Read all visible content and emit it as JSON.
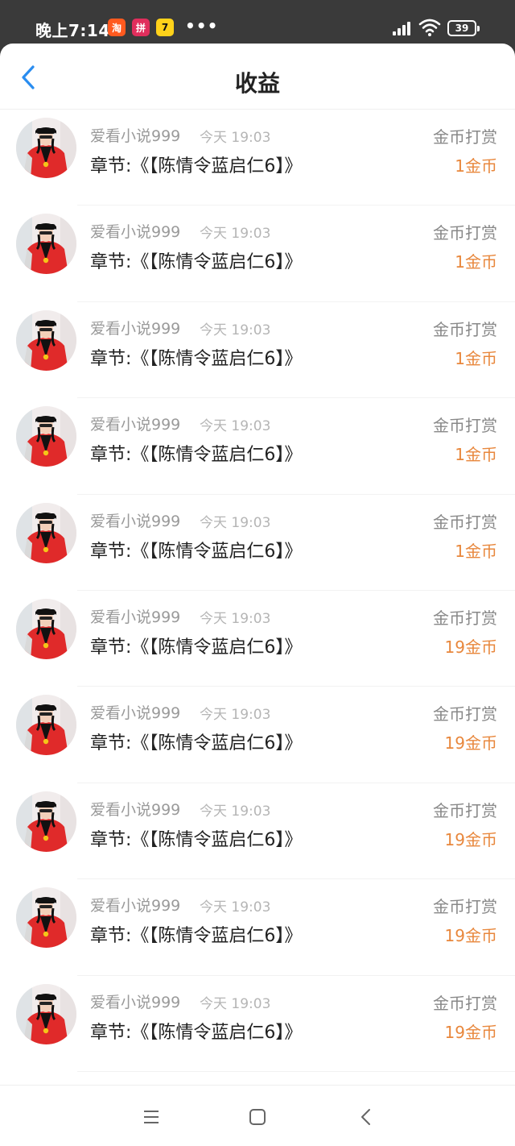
{
  "status_bar": {
    "time": "晚上7:14",
    "app_icons": [
      {
        "name": "taobao-app-icon",
        "glyph": "淘"
      },
      {
        "name": "pinduoduo-app-icon",
        "glyph": "拼"
      },
      {
        "name": "seven-app-icon",
        "glyph": "7"
      }
    ],
    "more": "•••",
    "battery": "39"
  },
  "header": {
    "title": "收益",
    "back_icon": "chevron-left-icon"
  },
  "records": [
    {
      "sender": "爱看小说999",
      "time": "今天 19:03",
      "chapter": "章节:《【陈情令蓝启仁6】》",
      "type": "金币打赏",
      "amount": "1金币"
    },
    {
      "sender": "爱看小说999",
      "time": "今天 19:03",
      "chapter": "章节:《【陈情令蓝启仁6】》",
      "type": "金币打赏",
      "amount": "1金币"
    },
    {
      "sender": "爱看小说999",
      "time": "今天 19:03",
      "chapter": "章节:《【陈情令蓝启仁6】》",
      "type": "金币打赏",
      "amount": "1金币"
    },
    {
      "sender": "爱看小说999",
      "time": "今天 19:03",
      "chapter": "章节:《【陈情令蓝启仁6】》",
      "type": "金币打赏",
      "amount": "1金币"
    },
    {
      "sender": "爱看小说999",
      "time": "今天 19:03",
      "chapter": "章节:《【陈情令蓝启仁6】》",
      "type": "金币打赏",
      "amount": "1金币"
    },
    {
      "sender": "爱看小说999",
      "time": "今天 19:03",
      "chapter": "章节:《【陈情令蓝启仁6】》",
      "type": "金币打赏",
      "amount": "19金币"
    },
    {
      "sender": "爱看小说999",
      "time": "今天 19:03",
      "chapter": "章节:《【陈情令蓝启仁6】》",
      "type": "金币打赏",
      "amount": "19金币"
    },
    {
      "sender": "爱看小说999",
      "time": "今天 19:03",
      "chapter": "章节:《【陈情令蓝启仁6】》",
      "type": "金币打赏",
      "amount": "19金币"
    },
    {
      "sender": "爱看小说999",
      "time": "今天 19:03",
      "chapter": "章节:《【陈情令蓝启仁6】》",
      "type": "金币打赏",
      "amount": "19金币"
    },
    {
      "sender": "爱看小说999",
      "time": "今天 19:03",
      "chapter": "章节:《【陈情令蓝启仁6】》",
      "type": "金币打赏",
      "amount": "19金币"
    }
  ],
  "colors": {
    "accent": "#2a8df0",
    "amount": "#e8873c",
    "status_bar": "#3a3a3a"
  },
  "nav_bar": {
    "icons": [
      "menu-icon",
      "home-square-icon",
      "back-triangle-icon"
    ]
  }
}
